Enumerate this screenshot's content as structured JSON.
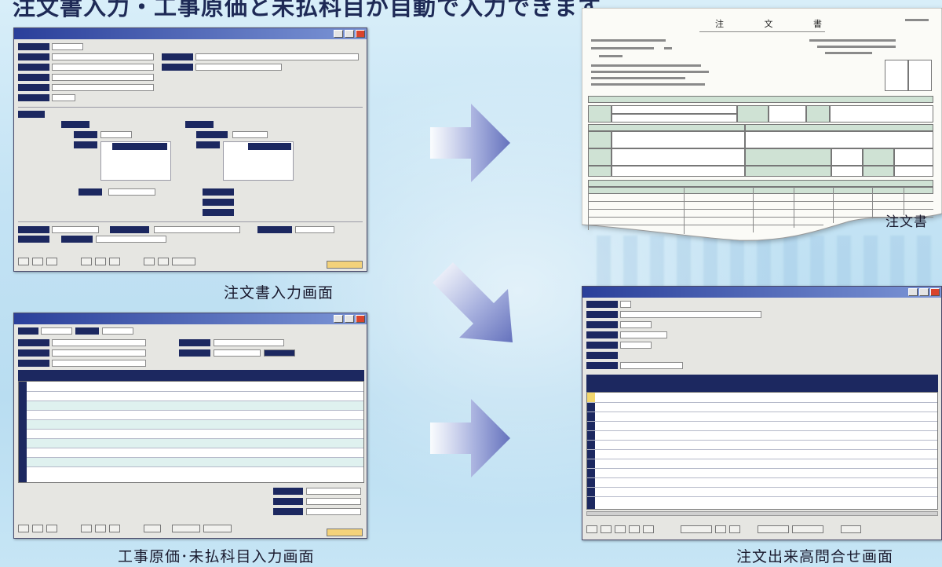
{
  "headline": "注文書入力・工事原価と未払科目が自動で入力できます。",
  "captions": {
    "order_entry": "注文書入力画面",
    "cost_entry": "工事原価･未払科目入力画面",
    "order_document": "注文書",
    "progress_inquiry": "注文出来高問合せ画面"
  },
  "document": {
    "title": "注 文 書"
  },
  "colors": {
    "title_bar": "#2a3f9a",
    "label_navy": "#1c2860",
    "arrow": "#7b86c9",
    "doc_green": "#cfe2d4",
    "background": "#c4e3f4"
  },
  "icons": {
    "arrow": "right-arrow-icon",
    "arrow_diag": "diagonal-arrow-icon"
  }
}
